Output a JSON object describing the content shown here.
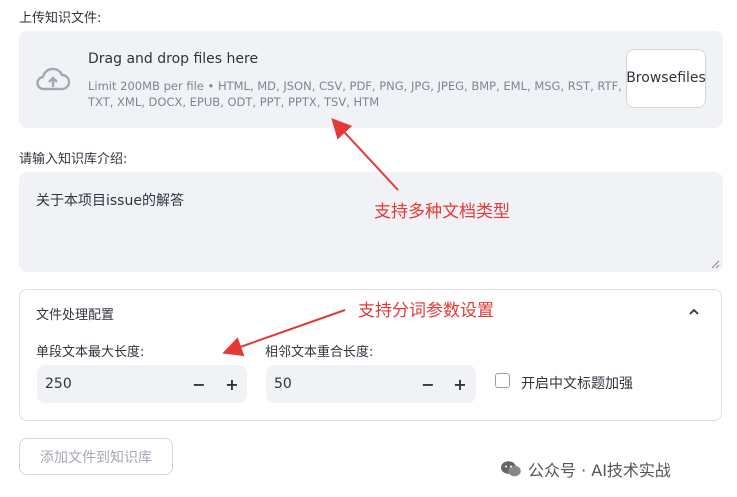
{
  "upload": {
    "label": "上传知识文件:",
    "drag_text": "Drag and drop files here",
    "limit_text": "Limit 200MB per file • HTML, MD, JSON, CSV, PDF, PNG, JPG, JPEG, BMP, EML, MSG, RST, RTF, TXT, XML, DOCX, EPUB, ODT, PPT, PPTX, TSV, HTM",
    "browse_label": "Browse files",
    "icon": "cloud-upload-icon"
  },
  "intro": {
    "label": "请输入知识库介绍:",
    "value": "关于本项目issue的解答"
  },
  "config": {
    "title": "文件处理配置",
    "chunk_size": {
      "label": "单段文本最大长度:",
      "value": "250"
    },
    "overlap": {
      "label": "相邻文本重合长度:",
      "value": "50"
    },
    "zh_title_enhance": {
      "label": "开启中文标题加强",
      "checked": false
    },
    "minus": "−",
    "plus": "+"
  },
  "add_button": "添加文件到知识库",
  "annotations": {
    "doc_types": "支持多种文档类型",
    "split_params": "支持分词参数设置",
    "color": "#e53935"
  },
  "watermark": "公众号 · AI技术实战"
}
